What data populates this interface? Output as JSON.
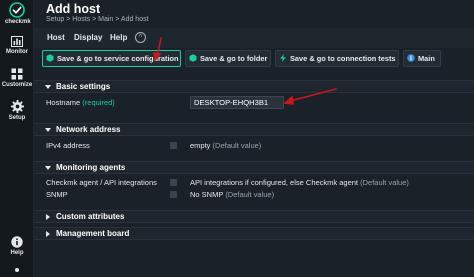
{
  "app": {
    "logo_text": "checkmk",
    "accent_color": "#15d1a0",
    "annotation_color": "#c8171e"
  },
  "sidebar": {
    "items": [
      {
        "label": "Monitor",
        "icon": "bar-chart-icon"
      },
      {
        "label": "Customize",
        "icon": "grid-icon"
      },
      {
        "label": "Setup",
        "icon": "gear-icon"
      },
      {
        "label": "Help",
        "icon": "info-icon"
      }
    ]
  },
  "page": {
    "title": "Add host",
    "breadcrumb": "Setup > Hosts > Main > Add host"
  },
  "menubar": {
    "items": [
      "Host",
      "Display",
      "Help"
    ],
    "toggle_symbol": "^"
  },
  "toolbar": {
    "buttons": [
      {
        "label": "Save & go to service configuration",
        "icon": "save-icon"
      },
      {
        "label": "Save & go to folder",
        "icon": "save-icon"
      },
      {
        "label": "Save & go to connection tests",
        "icon": "lightning-icon"
      },
      {
        "label": "Main",
        "icon": "info-icon"
      }
    ]
  },
  "sections": {
    "basic": {
      "title": "Basic settings",
      "hostname_label": "Hostname",
      "hostname_required": "(required)",
      "hostname_value": "DESKTOP-EHQH3B1"
    },
    "network": {
      "title": "Network address",
      "ipv4_label": "IPv4 address",
      "ipv4_value": "empty",
      "ipv4_default": "(Default value)"
    },
    "monitoring": {
      "title": "Monitoring agents",
      "agent_label": "Checkmk agent / API integrations",
      "agent_value": "API integrations if configured, else Checkmk agent",
      "agent_default": "(Default value)",
      "snmp_label": "SNMP",
      "snmp_value": "No SNMP",
      "snmp_default": "(Default value)"
    },
    "custom": {
      "title": "Custom attributes"
    },
    "management": {
      "title": "Management board"
    }
  }
}
